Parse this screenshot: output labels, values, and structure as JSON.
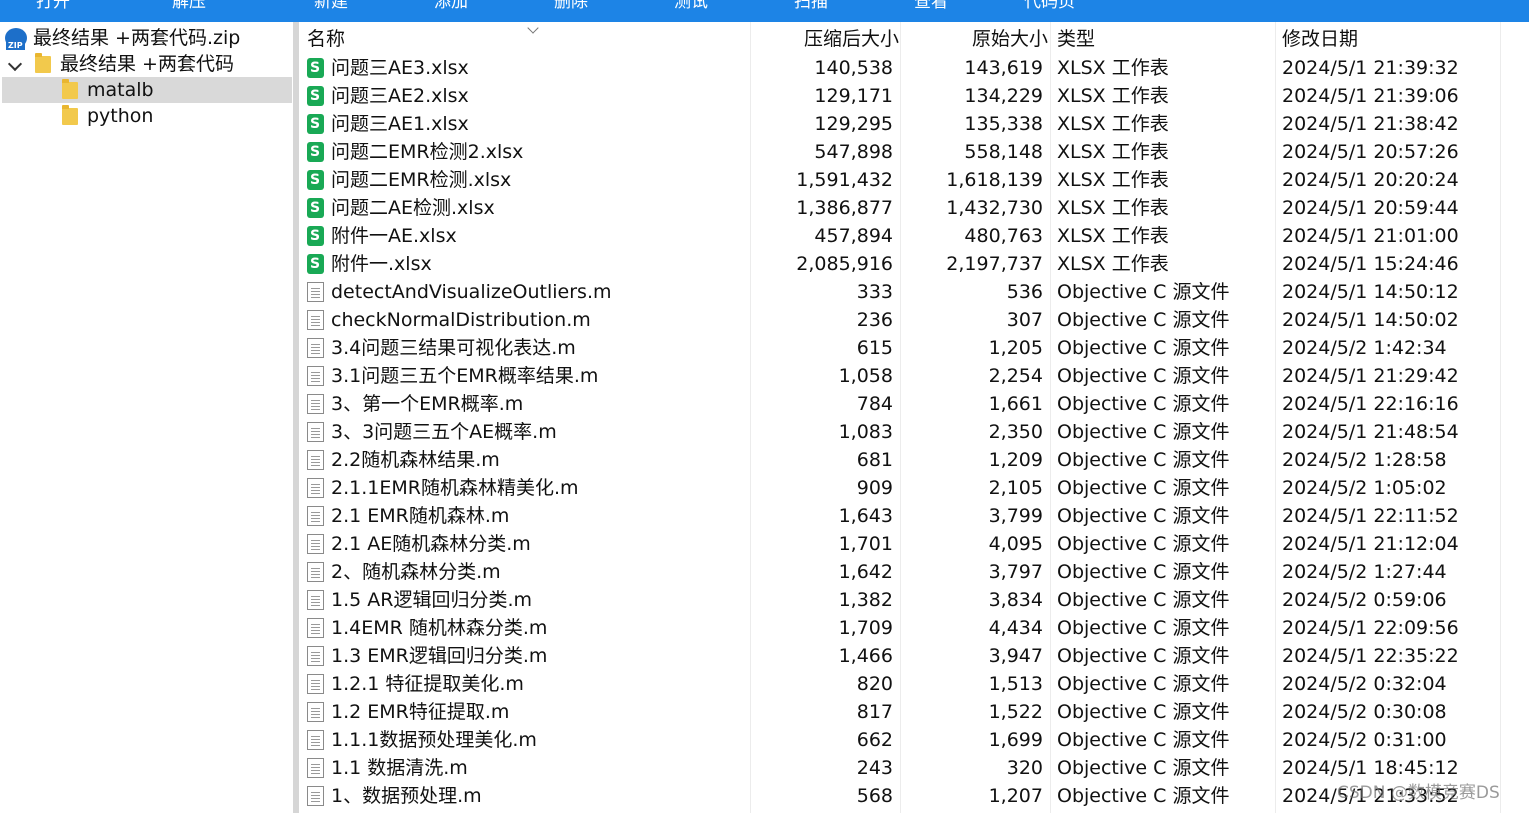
{
  "toolbar": {
    "buttons": [
      "打开",
      "解压",
      "新建",
      "添加",
      "删除",
      "测试",
      "扫描",
      "查看",
      "代码页"
    ]
  },
  "tree": {
    "items": [
      {
        "label": "最终结果 +两套代码.zip",
        "icon": "zip-icon"
      },
      {
        "label": "最终结果 +两套代码",
        "icon": "folder-icon",
        "expanded": true
      },
      {
        "label": "matalb",
        "icon": "folder-icon",
        "selected": true
      },
      {
        "label": "python",
        "icon": "folder-icon"
      }
    ]
  },
  "columns": {
    "name": "名称",
    "compressed": "压缩后大小",
    "original": "原始大小",
    "type": "类型",
    "modified": "修改日期"
  },
  "files": [
    {
      "name": "问题三AE3.xlsx",
      "compressed": "140,538",
      "original": "143,619",
      "type": "XLSX 工作表",
      "modified": "2024/5/1 21:39:32",
      "icon": "xlsx-icon"
    },
    {
      "name": "问题三AE2.xlsx",
      "compressed": "129,171",
      "original": "134,229",
      "type": "XLSX 工作表",
      "modified": "2024/5/1 21:39:06",
      "icon": "xlsx-icon"
    },
    {
      "name": "问题三AE1.xlsx",
      "compressed": "129,295",
      "original": "135,338",
      "type": "XLSX 工作表",
      "modified": "2024/5/1 21:38:42",
      "icon": "xlsx-icon"
    },
    {
      "name": "问题二EMR检测2.xlsx",
      "compressed": "547,898",
      "original": "558,148",
      "type": "XLSX 工作表",
      "modified": "2024/5/1 20:57:26",
      "icon": "xlsx-icon"
    },
    {
      "name": "问题二EMR检测.xlsx",
      "compressed": "1,591,432",
      "original": "1,618,139",
      "type": "XLSX 工作表",
      "modified": "2024/5/1 20:20:24",
      "icon": "xlsx-icon"
    },
    {
      "name": "问题二AE检测.xlsx",
      "compressed": "1,386,877",
      "original": "1,432,730",
      "type": "XLSX 工作表",
      "modified": "2024/5/1 20:59:44",
      "icon": "xlsx-icon"
    },
    {
      "name": "附件一AE.xlsx",
      "compressed": "457,894",
      "original": "480,763",
      "type": "XLSX 工作表",
      "modified": "2024/5/1 21:01:00",
      "icon": "xlsx-icon"
    },
    {
      "name": "附件一.xlsx",
      "compressed": "2,085,916",
      "original": "2,197,737",
      "type": "XLSX 工作表",
      "modified": "2024/5/1 15:24:46",
      "icon": "xlsx-icon"
    },
    {
      "name": "detectAndVisualizeOutliers.m",
      "compressed": "333",
      "original": "536",
      "type": "Objective C 源文件",
      "modified": "2024/5/1 14:50:12",
      "icon": "m-file-icon"
    },
    {
      "name": "checkNormalDistribution.m",
      "compressed": "236",
      "original": "307",
      "type": "Objective C 源文件",
      "modified": "2024/5/1 14:50:02",
      "icon": "m-file-icon"
    },
    {
      "name": "3.4问题三结果可视化表达.m",
      "compressed": "615",
      "original": "1,205",
      "type": "Objective C 源文件",
      "modified": "2024/5/2 1:42:34",
      "icon": "m-file-icon"
    },
    {
      "name": "3.1问题三五个EMR概率结果.m",
      "compressed": "1,058",
      "original": "2,254",
      "type": "Objective C 源文件",
      "modified": "2024/5/1 21:29:42",
      "icon": "m-file-icon"
    },
    {
      "name": "3、第一个EMR概率.m",
      "compressed": "784",
      "original": "1,661",
      "type": "Objective C 源文件",
      "modified": "2024/5/1 22:16:16",
      "icon": "m-file-icon"
    },
    {
      "name": "3、3问题三五个AE概率.m",
      "compressed": "1,083",
      "original": "2,350",
      "type": "Objective C 源文件",
      "modified": "2024/5/1 21:48:54",
      "icon": "m-file-icon"
    },
    {
      "name": "2.2随机森林结果.m",
      "compressed": "681",
      "original": "1,209",
      "type": "Objective C 源文件",
      "modified": "2024/5/2 1:28:58",
      "icon": "m-file-icon"
    },
    {
      "name": "2.1.1EMR随机森林精美化.m",
      "compressed": "909",
      "original": "2,105",
      "type": "Objective C 源文件",
      "modified": "2024/5/2 1:05:02",
      "icon": "m-file-icon"
    },
    {
      "name": "2.1 EMR随机森林.m",
      "compressed": "1,643",
      "original": "3,799",
      "type": "Objective C 源文件",
      "modified": "2024/5/1 22:11:52",
      "icon": "m-file-icon"
    },
    {
      "name": "2.1 AE随机森林分类.m",
      "compressed": "1,701",
      "original": "4,095",
      "type": "Objective C 源文件",
      "modified": "2024/5/1 21:12:04",
      "icon": "m-file-icon"
    },
    {
      "name": "2、随机森林分类.m",
      "compressed": "1,642",
      "original": "3,797",
      "type": "Objective C 源文件",
      "modified": "2024/5/2 1:27:44",
      "icon": "m-file-icon"
    },
    {
      "name": "1.5 AR逻辑回归分类.m",
      "compressed": "1,382",
      "original": "3,834",
      "type": "Objective C 源文件",
      "modified": "2024/5/2 0:59:06",
      "icon": "m-file-icon"
    },
    {
      "name": "1.4EMR 随机林森分类.m",
      "compressed": "1,709",
      "original": "4,434",
      "type": "Objective C 源文件",
      "modified": "2024/5/1 22:09:56",
      "icon": "m-file-icon"
    },
    {
      "name": "1.3 EMR逻辑回归分类.m",
      "compressed": "1,466",
      "original": "3,947",
      "type": "Objective C 源文件",
      "modified": "2024/5/1 22:35:22",
      "icon": "m-file-icon"
    },
    {
      "name": "1.2.1 特征提取美化.m",
      "compressed": "820",
      "original": "1,513",
      "type": "Objective C 源文件",
      "modified": "2024/5/2 0:32:04",
      "icon": "m-file-icon"
    },
    {
      "name": "1.2 EMR特征提取.m",
      "compressed": "817",
      "original": "1,522",
      "type": "Objective C 源文件",
      "modified": "2024/5/2 0:30:08",
      "icon": "m-file-icon"
    },
    {
      "name": "1.1.1数据预处理美化.m",
      "compressed": "662",
      "original": "1,699",
      "type": "Objective C 源文件",
      "modified": "2024/5/2 0:31:00",
      "icon": "m-file-icon"
    },
    {
      "name": "1.1 数据清洗.m",
      "compressed": "243",
      "original": "320",
      "type": "Objective C 源文件",
      "modified": "2024/5/1 18:45:12",
      "icon": "m-file-icon"
    },
    {
      "name": "1、数据预处理.m",
      "compressed": "568",
      "original": "1,207",
      "type": "Objective C 源文件",
      "modified": "2024/5/1 21:33:52",
      "icon": "m-file-icon"
    }
  ],
  "watermark": "CSDN @数模竞赛DS",
  "colors": {
    "toolbar": "#1d84e6",
    "selected_row": "#d9d9d9",
    "xlsx_icon": "#19a955",
    "folder": "#f2c94c"
  }
}
